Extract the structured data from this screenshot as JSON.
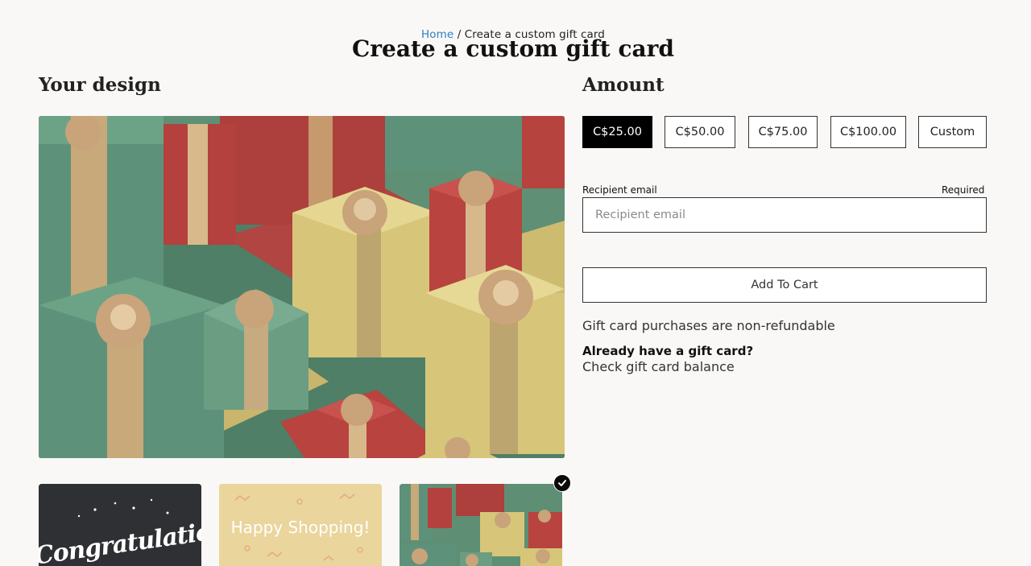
{
  "breadcrumb": {
    "home": "Home",
    "separator": "/",
    "current": "Create a custom gift card"
  },
  "page_title": "Create a custom gift card",
  "design": {
    "heading": "Your design",
    "thumbnails": [
      {
        "name": "congratulations",
        "text": "Congratulations",
        "selected": false
      },
      {
        "name": "happy-shopping",
        "text": "Happy Shopping!",
        "selected": false
      },
      {
        "name": "gift-boxes",
        "text": "",
        "selected": true
      }
    ],
    "selected_icon": "check-icon"
  },
  "amount": {
    "heading": "Amount",
    "options": [
      "C$25.00",
      "C$50.00",
      "C$75.00",
      "C$100.00",
      "Custom"
    ],
    "selected": "C$25.00"
  },
  "recipient": {
    "label": "Recipient email",
    "required": "Required",
    "placeholder": "Recipient email",
    "value": ""
  },
  "add_to_cart": "Add To Cart",
  "policy": "Gift card purchases are non-refundable",
  "have_card": "Already have a gift card?",
  "balance_link": "Check gift card balance",
  "colors": {
    "accent_link": "#2f7fc1",
    "selected_bg": "#000000",
    "gift_green": "#5e917a",
    "gift_red": "#b8423f",
    "gift_yellow": "#d8c678",
    "ribbon_gold": "#d9b98a"
  }
}
